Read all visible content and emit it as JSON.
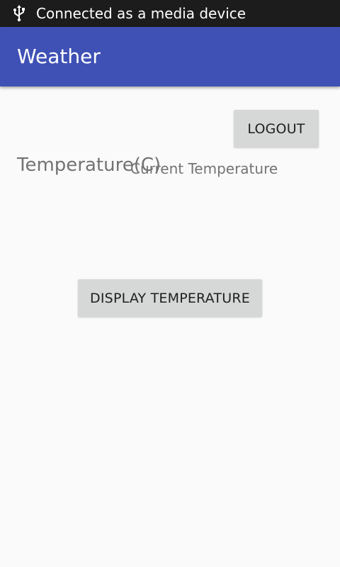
{
  "status_bar": {
    "icon": "usb-icon",
    "text": "Connected as a media device"
  },
  "app_bar": {
    "title": "Weather",
    "color": "#3f51b5"
  },
  "actions": {
    "logout_label": "LOGOUT",
    "display_label": "DISPLAY TEMPERATURE"
  },
  "content": {
    "temperature_label": "Temperature(C)",
    "current_temperature": "Current Temperature"
  }
}
